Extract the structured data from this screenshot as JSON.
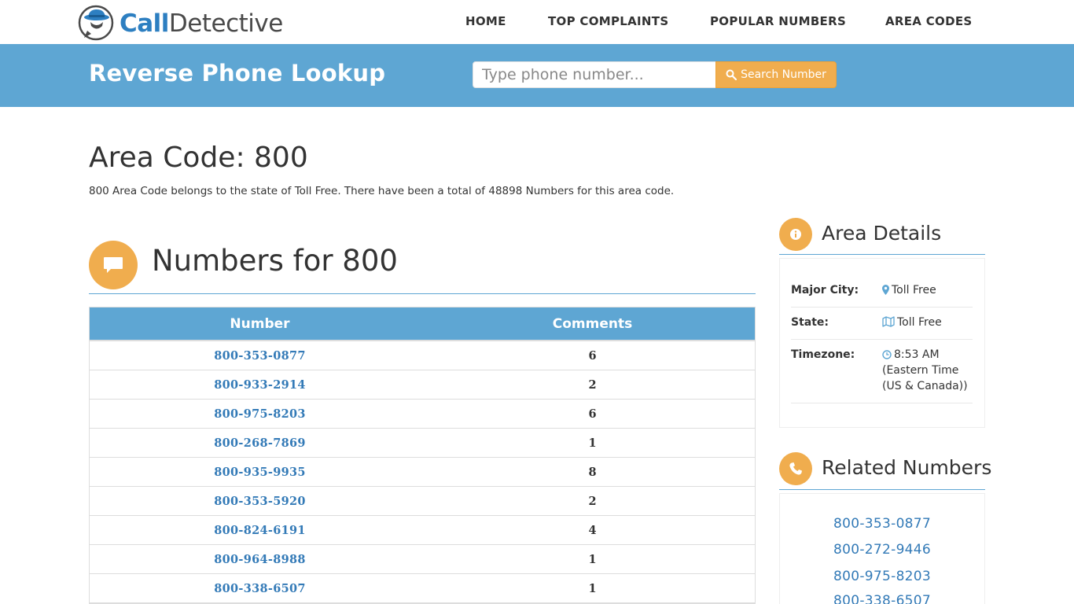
{
  "brand": {
    "name_part1": "Call",
    "name_part2": "Detective"
  },
  "nav": {
    "items": [
      {
        "label": "HOME"
      },
      {
        "label": "TOP COMPLAINTS"
      },
      {
        "label": "POPULAR NUMBERS"
      },
      {
        "label": "AREA CODES"
      }
    ]
  },
  "band": {
    "title": "Reverse Phone Lookup",
    "search_placeholder": "Type phone number...",
    "search_button": "Search Number"
  },
  "page": {
    "title": "Area Code: 800",
    "intro": "800 Area Code belongs to the state of Toll Free. There have been a total of 48898 Numbers for this area code."
  },
  "numbers_section": {
    "title": "Numbers for 800",
    "columns": [
      "Number",
      "Comments"
    ],
    "rows": [
      {
        "number": "800-353-0877",
        "comments": "6"
      },
      {
        "number": "800-933-2914",
        "comments": "2"
      },
      {
        "number": "800-975-8203",
        "comments": "6"
      },
      {
        "number": "800-268-7869",
        "comments": "1"
      },
      {
        "number": "800-935-9935",
        "comments": "8"
      },
      {
        "number": "800-353-5920",
        "comments": "2"
      },
      {
        "number": "800-824-6191",
        "comments": "4"
      },
      {
        "number": "800-964-8988",
        "comments": "1"
      },
      {
        "number": "800-338-6507",
        "comments": "1"
      }
    ]
  },
  "area_details": {
    "title": "Area Details",
    "rows": [
      {
        "label": "Major City:",
        "icon": "map-marker-icon",
        "value": "Toll Free"
      },
      {
        "label": "State:",
        "icon": "map-icon",
        "value": "Toll Free"
      },
      {
        "label": "Timezone:",
        "icon": "clock-icon",
        "value_lines": [
          "8:53 AM",
          "(Eastern Time",
          "(US & Canada))"
        ]
      }
    ]
  },
  "related": {
    "title": "Related Numbers",
    "numbers": [
      "800-353-0877",
      "800-272-9446",
      "800-975-8203",
      "800-338-6507"
    ]
  },
  "colors": {
    "brand_blue": "#5ea6d3",
    "accent_orange": "#f0ad4e",
    "link_blue": "#337ab7"
  }
}
